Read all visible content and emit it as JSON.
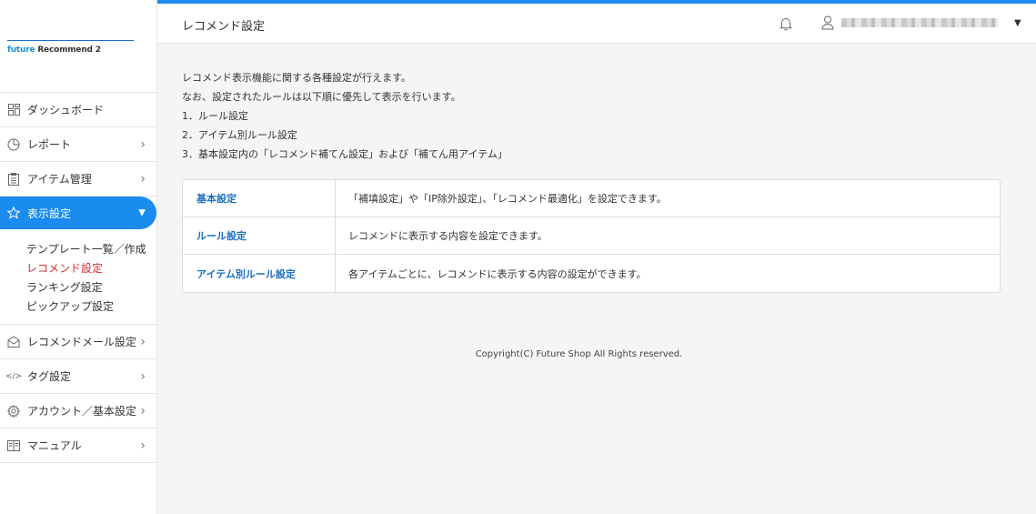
{
  "logo": {
    "brand": "future",
    "product": "Recommend 2"
  },
  "header": {
    "title": "レコメンド設定"
  },
  "sidebar": {
    "items": [
      {
        "label": "ダッシュボード"
      },
      {
        "label": "レポート"
      },
      {
        "label": "アイテム管理"
      },
      {
        "label": "表示設定"
      },
      {
        "label": "レコメンドメール設定"
      },
      {
        "label": "タグ設定"
      },
      {
        "label": "アカウント／基本設定"
      },
      {
        "label": "マニュアル"
      }
    ],
    "submenu": [
      {
        "label": "テンプレート一覧／作成"
      },
      {
        "label": "レコメンド設定"
      },
      {
        "label": "ランキング設定"
      },
      {
        "label": "ピックアップ設定"
      }
    ]
  },
  "main": {
    "description": [
      "レコメンド表示機能に関する各種設定が行えます。",
      "なお、設定されたルールは以下順に優先して表示を行います。",
      "1．ルール設定",
      "2．アイテム別ルール設定",
      "3．基本設定内の「レコメンド補てん設定」および「補てん用アイテム」"
    ],
    "rows": [
      {
        "label": "基本設定",
        "desc": "「補填設定」や「IP除外設定」、「レコメンド最適化」を設定できます。"
      },
      {
        "label": "ルール設定",
        "desc": "レコメンドに表示する内容を設定できます。"
      },
      {
        "label": "アイテム別ルール設定",
        "desc": "各アイテムごとに、レコメンドに表示する内容の設定ができます。"
      }
    ],
    "copyright": "Copyright(C) Future Shop All Rights reserved."
  },
  "colors": {
    "accent": "#1a8cf0",
    "link": "#1a6fc4",
    "current": "#d32f2f"
  }
}
